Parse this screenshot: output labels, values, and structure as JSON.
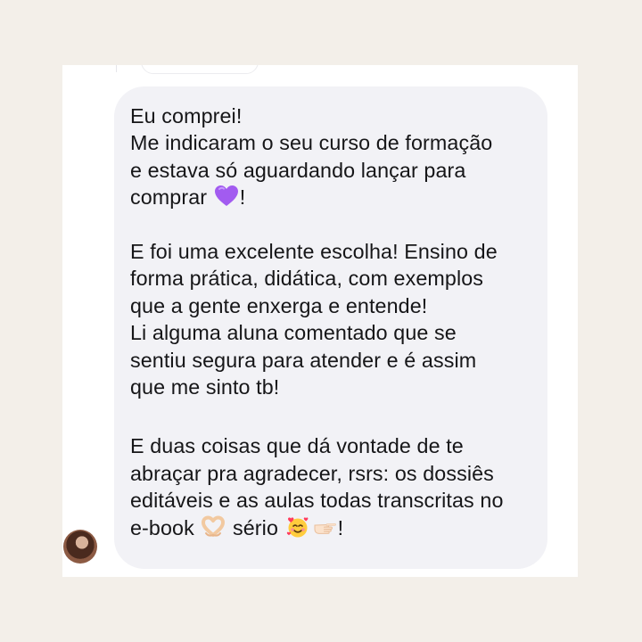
{
  "message": {
    "lines": [
      "Eu comprei!",
      "Me indicaram o seu curso de formação",
      "e estava só aguardando lançar para",
      "comprar",
      "!",
      "E foi uma excelente escolha! Ensino de",
      "forma prática, didática, com exemplos",
      "que a gente enxerga e entende!",
      "Li alguma aluna comentado que se",
      "sentiu segura para atender e é assim",
      "que me sinto tb!",
      "E duas coisas que dá vontade de te",
      "abraçar pra agradecer, rsrs: os dossiês",
      "editáveis e as aulas todas transcritas no",
      "e-book",
      "sério",
      "!"
    ]
  },
  "icons": {
    "purple_heart": "purple-heart-icon",
    "heart_hands": "heart-hands-icon",
    "smiling_hearts": "smiling-face-with-hearts-icon",
    "pointing_hand": "pointing-hand-icon"
  },
  "colors": {
    "background": "#f3efe9",
    "card": "#ffffff",
    "bubble": "#f2f2f6",
    "text": "#161618"
  }
}
